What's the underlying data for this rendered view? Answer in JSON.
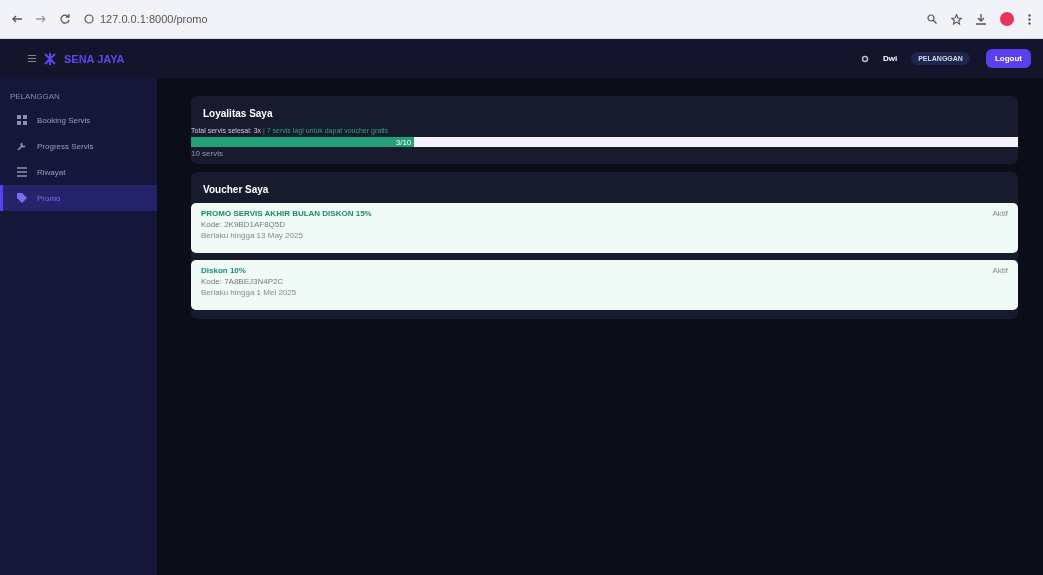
{
  "browser": {
    "url": "127.0.0.1:8000/promo"
  },
  "navbar": {
    "brand": "SENA JAYA",
    "user": "Dwi",
    "role": "PELANGGAN",
    "logout": "Logout"
  },
  "sidebar": {
    "heading": "PELANGGAN",
    "items": [
      {
        "label": "Booking Servis",
        "kind": "grid",
        "selected": false
      },
      {
        "label": "Progress Servis",
        "kind": "wrench",
        "selected": false
      },
      {
        "label": "Riwayat",
        "kind": "list",
        "selected": false
      },
      {
        "label": "Promo",
        "kind": "tag",
        "selected": true
      }
    ]
  },
  "loyalty": {
    "title": "Loyalitas Saya",
    "summary": "Total servis selesai: 3x",
    "hint": "| 7 servis lagi untuk dapat voucher gratis",
    "level": 0.27,
    "bar_label": "3/10",
    "caption": "10 servis"
  },
  "vouchers": {
    "title": "Voucher Saya",
    "items": [
      {
        "name": "PROMO SERVIS AKHIR BULAN DISKON 15%",
        "code": "Kode: 2K9BD1AF8Q5D",
        "valid": "Berlaku hingga 13 May 2025",
        "status": "Aktif"
      },
      {
        "name": "Diskon 10%",
        "code": "Kode: 7A8BEJ3N4P2C",
        "valid": "Berlaku hingga 1 Mei 2025",
        "status": "Aktif"
      }
    ]
  }
}
